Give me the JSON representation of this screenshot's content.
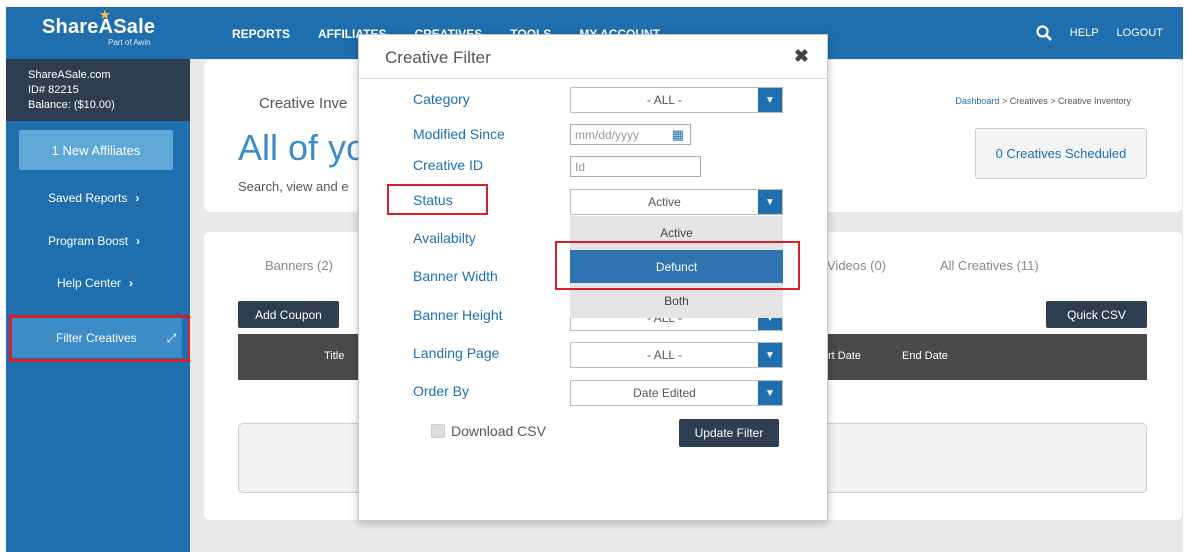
{
  "header": {
    "logo": "ShareASale",
    "logo_sub": "Part of Awin",
    "nav": [
      "REPORTS",
      "AFFILIATES",
      "CREATIVES",
      "TOOLS",
      "MY ACCOUNT"
    ],
    "help": "HELP",
    "logout": "LOGOUT"
  },
  "sidebar": {
    "account_name": "ShareASale.com",
    "account_id": "ID# 82215",
    "balance": "Balance: ($10.00)",
    "new_affiliates": "1 New Affiliates",
    "saved_reports": "Saved Reports",
    "program_boost": "Program Boost",
    "help_center": "Help Center",
    "filter_creatives": "Filter Creatives"
  },
  "page": {
    "section_title": "Creative Inve",
    "big_title": "All of yo",
    "subtitle": "Search, view and e",
    "breadcrumb": {
      "dashboard": "Dashboard",
      "sep1": " > Creatives > Creative Inventory"
    },
    "scheduled": "0 Creatives Scheduled",
    "tabs": {
      "banners": "Banners (2)",
      "videos": "Videos (0)",
      "all": "All Creatives (11)"
    },
    "add_coupon": "Add Coupon",
    "quick_csv": "Quick CSV",
    "columns": {
      "title": "Title",
      "start_date": "rt Date",
      "end_date": "End Date"
    }
  },
  "modal": {
    "title": "Creative Filter",
    "close": "✖",
    "labels": {
      "category": "Category",
      "modified_since": "Modified Since",
      "creative_id": "Creative ID",
      "status": "Status",
      "availability": "Availabilty",
      "banner_width": "Banner Width",
      "banner_height": "Banner Height",
      "landing_page": "Landing Page",
      "order_by": "Order By"
    },
    "category_value": "- ALL -",
    "modified_placeholder": "mm/dd/yyyy",
    "creative_id_placeholder": "Id",
    "status_value": "Active",
    "status_options": [
      "Active",
      "Defunct",
      "Both"
    ],
    "banner_height_value": "- ALL -",
    "landing_page_value": "- ALL -",
    "order_by_value": "Date Edited",
    "download_csv": "Download CSV",
    "update_filter": "Update Filter"
  },
  "colors": {
    "brand": "#1f6fae",
    "dark": "#2c3e50",
    "highlight": "#d91f26"
  }
}
